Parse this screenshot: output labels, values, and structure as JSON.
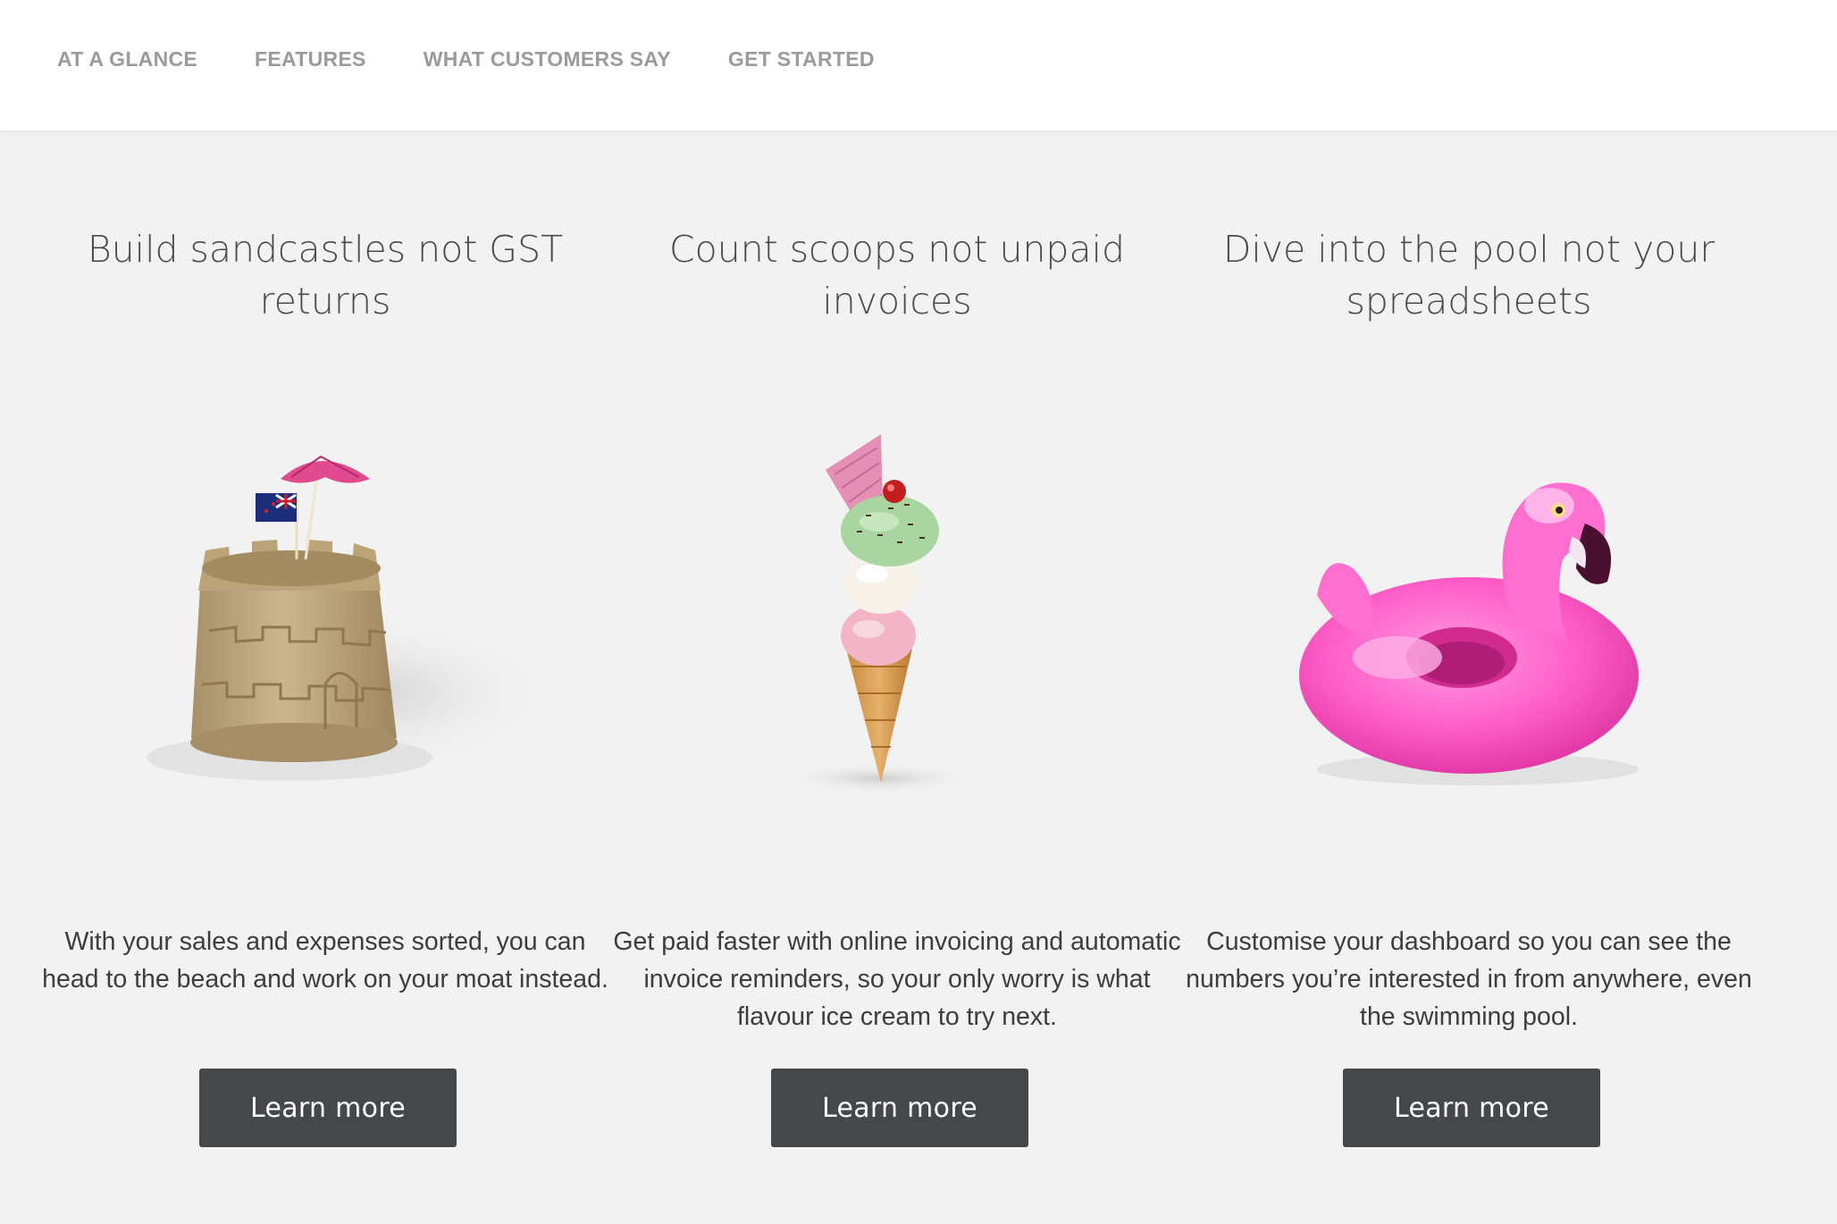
{
  "nav": {
    "items": [
      {
        "label": "AT A GLANCE"
      },
      {
        "label": "FEATURES"
      },
      {
        "label": "WHAT CUSTOMERS SAY"
      },
      {
        "label": "GET STARTED"
      }
    ]
  },
  "features": [
    {
      "title": "Build sandcastles not GST returns",
      "description": "With your sales and expenses sorted, you can head to the beach and work on your moat instead.",
      "button_label": "Learn more",
      "image": "sandcastle-with-flag-and-umbrella"
    },
    {
      "title": "Count scoops not unpaid invoices",
      "description": "Get paid faster with online invoicing and automatic invoice reminders, so your only worry is what flavour ice cream to try next.",
      "button_label": "Learn more",
      "image": "ice-cream-cone-with-wafer-and-cherry"
    },
    {
      "title": "Dive into the pool not your spreadsheets",
      "description": "Customise your dashboard so you can see the numbers you’re interested in from anywhere, even the swimming pool.",
      "button_label": "Learn more",
      "image": "inflatable-pink-flamingo"
    }
  ],
  "colors": {
    "page_background": "#f2f2f2",
    "nav_background": "#ffffff",
    "nav_text": "#9b9b9b",
    "button_background": "#46474b",
    "button_text": "#ffffff",
    "flamingo_pink": "#ff5fc8"
  }
}
